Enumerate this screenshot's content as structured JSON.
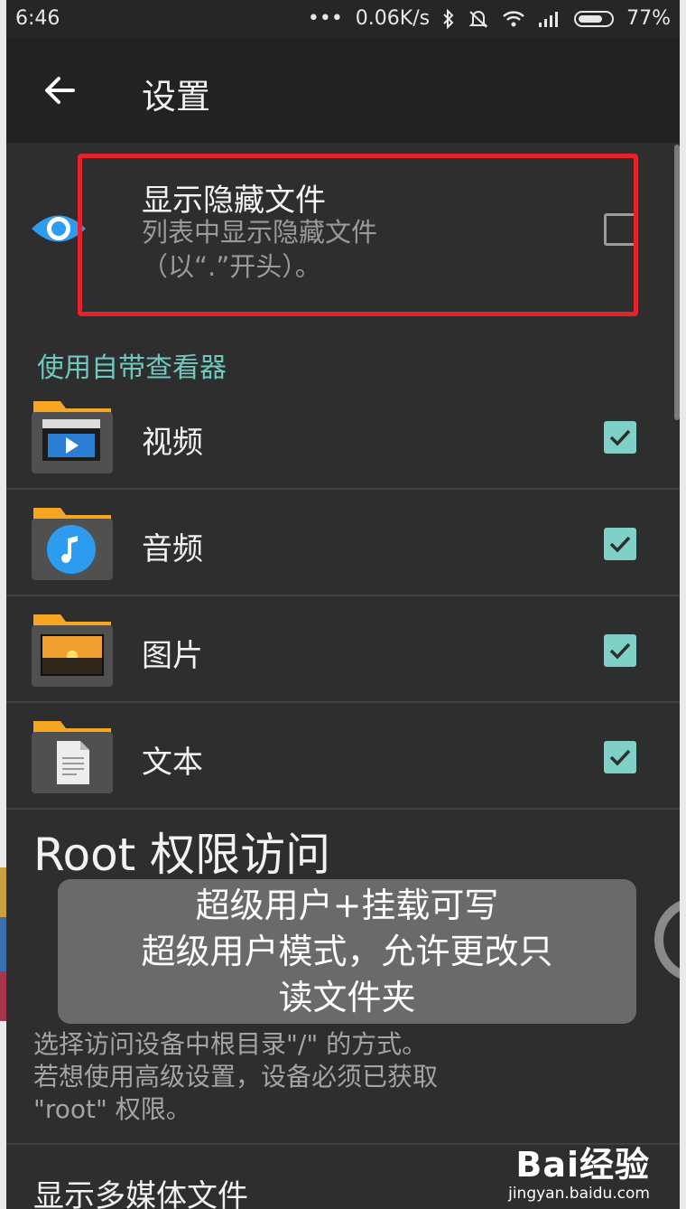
{
  "status_bar": {
    "time": "6:46",
    "dots": "•••",
    "network_speed": "0.06K/s",
    "battery_level": 0.77,
    "battery_text": "77%"
  },
  "toolbar": {
    "back_icon": "arrow-left-icon",
    "title": "设置"
  },
  "hidden_files": {
    "title": "显示隐藏文件",
    "subtitle": "列表中显示隐藏文件（以“.”开头）。",
    "checked": false,
    "icon": "eye-icon"
  },
  "viewer_section": {
    "header": "使用自带查看器",
    "items": [
      {
        "label": "视频",
        "icon": "video-folder-icon",
        "checked": true
      },
      {
        "label": "音频",
        "icon": "music-folder-icon",
        "checked": true
      },
      {
        "label": "图片",
        "icon": "image-folder-icon",
        "checked": true
      },
      {
        "label": "文本",
        "icon": "document-folder-icon",
        "checked": true
      }
    ]
  },
  "root_section": {
    "title": "Root 权限访问",
    "description_line1": "选择访问设备中根目录\"/\" 的方式。",
    "description_line2": "若想使用高级设置，设备必须已获取",
    "description_line3": "\"root\" 权限。"
  },
  "toast": {
    "line1": "超级用户+挂载可写",
    "line2": "超级用户模式，允许更改只",
    "line3": "读文件夹"
  },
  "media_section": {
    "title": "显示多媒体文件"
  },
  "watermark": {
    "brand": "Bai经验",
    "url": "jingyan.baidu.com"
  },
  "colors": {
    "accent": "#7fd0c6",
    "section_header": "#6ec8bd",
    "highlight": "#e3232c",
    "background": "#2e2e2e",
    "toolbar": "#222222"
  }
}
